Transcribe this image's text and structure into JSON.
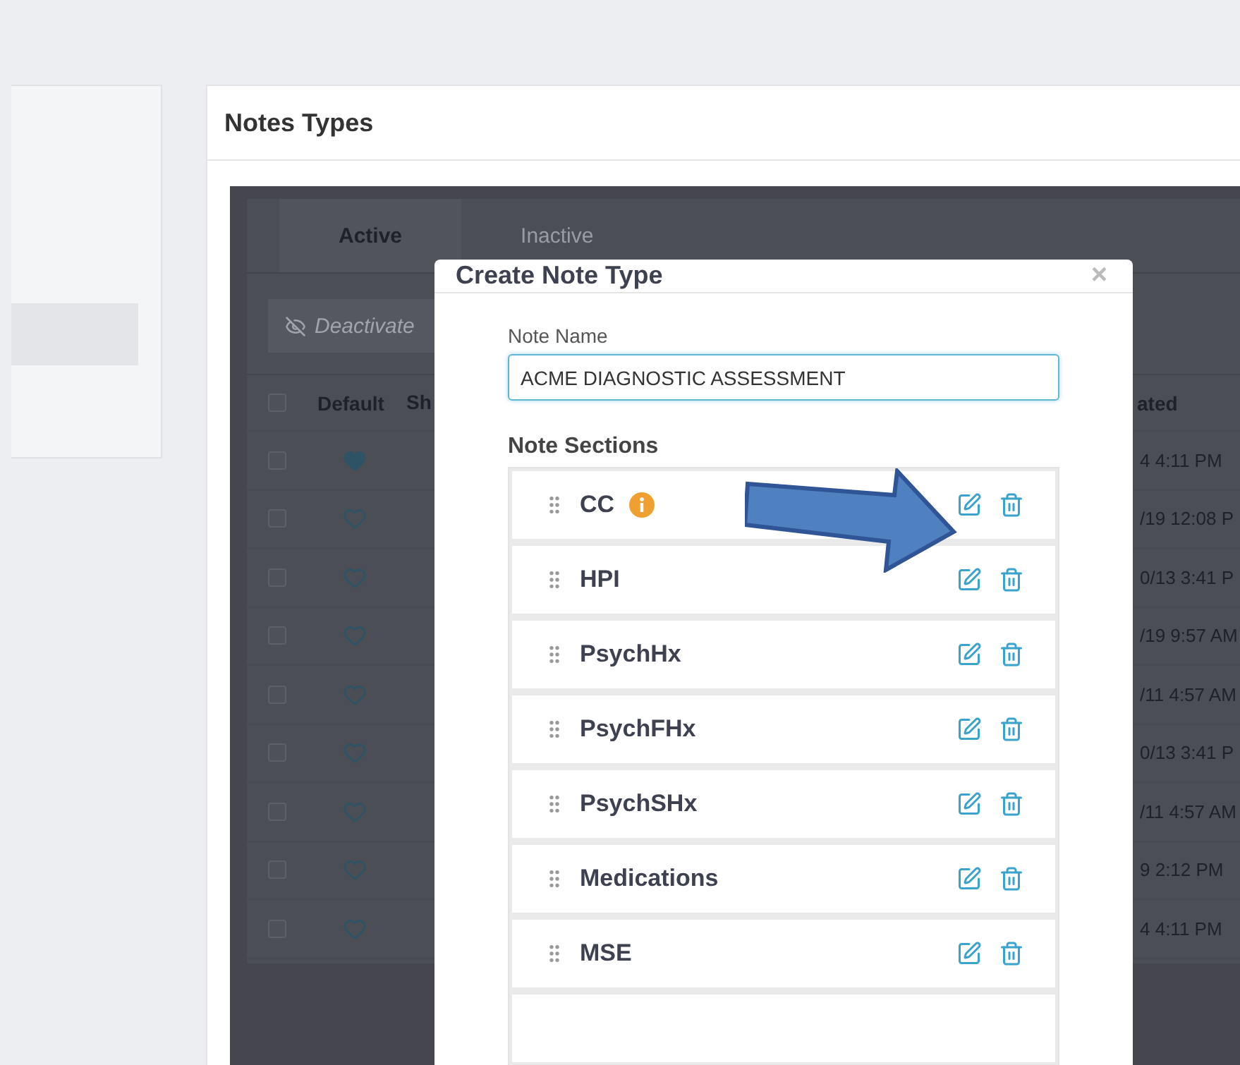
{
  "card": {
    "title": "Notes Types"
  },
  "tabs": [
    {
      "label": "Active",
      "selected": true
    },
    {
      "label": "Inactive",
      "selected": false
    }
  ],
  "toolbar": {
    "deactivate_button": "Deactivate"
  },
  "table": {
    "select_all_checked": false,
    "columns": [
      "Default",
      "Sh",
      "ated"
    ],
    "rows": [
      {
        "checked": false,
        "default": true,
        "column_3": "4 4:11 PM"
      },
      {
        "checked": false,
        "default": false,
        "column_3": "/19 12:08 P"
      },
      {
        "checked": false,
        "default": false,
        "column_3": "0/13 3:41 P"
      },
      {
        "checked": false,
        "default": false,
        "column_3": "/19 9:57 AM"
      },
      {
        "checked": false,
        "default": false,
        "column_3": "/11 4:57 AM"
      },
      {
        "checked": false,
        "default": false,
        "column_3": "0/13 3:41 P"
      },
      {
        "checked": false,
        "default": false,
        "column_3": "/11 4:57 AM"
      },
      {
        "checked": false,
        "default": false,
        "column_3": "9 2:12 PM"
      },
      {
        "checked": false,
        "default": false,
        "column_3": "4 4:11 PM"
      }
    ]
  },
  "dialog": {
    "title": "Create Note Type",
    "close": "×",
    "note_name": {
      "label": "Note Name",
      "value": "ACME DIAGNOSTIC ASSESSMENT"
    },
    "sections_label": "Note Sections",
    "sections": [
      {
        "name": "CC",
        "info": true
      },
      {
        "name": "HPI",
        "info": false
      },
      {
        "name": "PsychHx",
        "info": false
      },
      {
        "name": "PsychFHx",
        "info": false
      },
      {
        "name": "PsychSHx",
        "info": false
      },
      {
        "name": "Medications",
        "info": false
      },
      {
        "name": "MSE",
        "info": false
      }
    ]
  }
}
